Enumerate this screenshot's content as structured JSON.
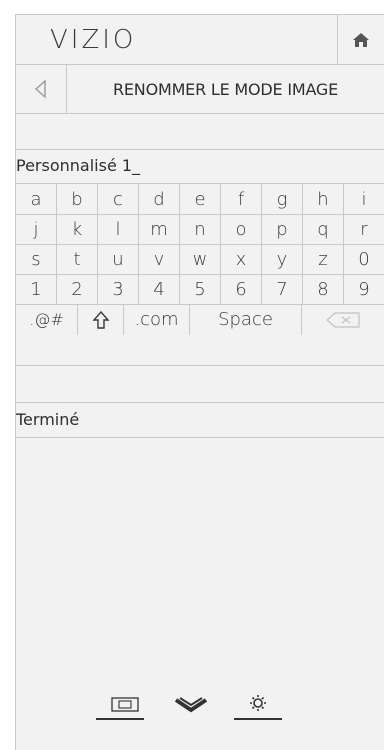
{
  "header": {
    "logo": "VIZIO",
    "home_icon": "home-icon"
  },
  "titlebar": {
    "back_icon": "back-arrow-icon",
    "title": "RENOMMER LE MODE IMAGE"
  },
  "input": {
    "value": "Personnalisé 1_"
  },
  "keyboard": {
    "rows": [
      [
        "a",
        "b",
        "c",
        "d",
        "e",
        "f",
        "g",
        "h",
        "i"
      ],
      [
        "j",
        "k",
        "l",
        "m",
        "n",
        "o",
        "p",
        "q",
        "r"
      ],
      [
        "s",
        "t",
        "u",
        "v",
        "w",
        "x",
        "y",
        "z",
        "0"
      ],
      [
        "1",
        "2",
        "3",
        "4",
        "5",
        "6",
        "7",
        "8",
        "9"
      ]
    ],
    "symbols_label": ".@#",
    "dotcom_label": ".com",
    "space_label": "Space",
    "shift_icon": "shift-arrow-icon",
    "backspace_icon": "backspace-icon"
  },
  "done": {
    "label": "Terminé"
  },
  "bottom_nav": {
    "icons": [
      "picture-icon",
      "chevron-down-icon",
      "gear-icon"
    ]
  },
  "colors": {
    "panel_bg": "#f2f2f2",
    "divider": "#c9c9c9",
    "text": "#2e2e2e"
  }
}
